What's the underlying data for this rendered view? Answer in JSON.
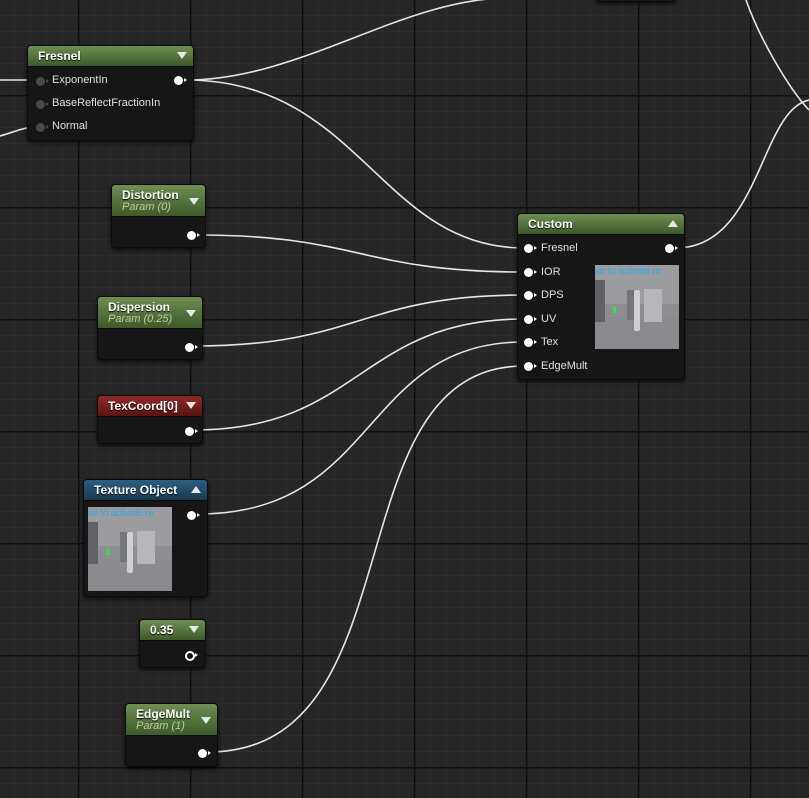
{
  "fresnel_node": {
    "title": "Fresnel",
    "inputs": [
      "ExponentIn",
      "BaseReflectFractionIn",
      "Normal"
    ]
  },
  "distortion_node": {
    "title": "Distortion",
    "subtitle": "Param (0)"
  },
  "dispersion_node": {
    "title": "Dispersion",
    "subtitle": "Param (0.25)"
  },
  "texcoord_node": {
    "title": "TexCoord[0]"
  },
  "texture_object_node": {
    "title": "Texture Object",
    "preview_text": "se to activate re"
  },
  "constant_node": {
    "title": "0.35"
  },
  "edgemult_node": {
    "title": "EdgeMult",
    "subtitle": "Param (1)"
  },
  "custom_node": {
    "title": "Custom",
    "inputs": [
      "Fresnel",
      "IOR",
      "DPS",
      "UV",
      "Tex",
      "EdgeMult"
    ],
    "preview_text": "se to activate re"
  },
  "colors": {
    "param_header": "#5b7a45",
    "texcoord_header": "#7a1f1a",
    "texture_header": "#245375",
    "wire": "#e8e8e8",
    "grid_bg": "#262626"
  }
}
